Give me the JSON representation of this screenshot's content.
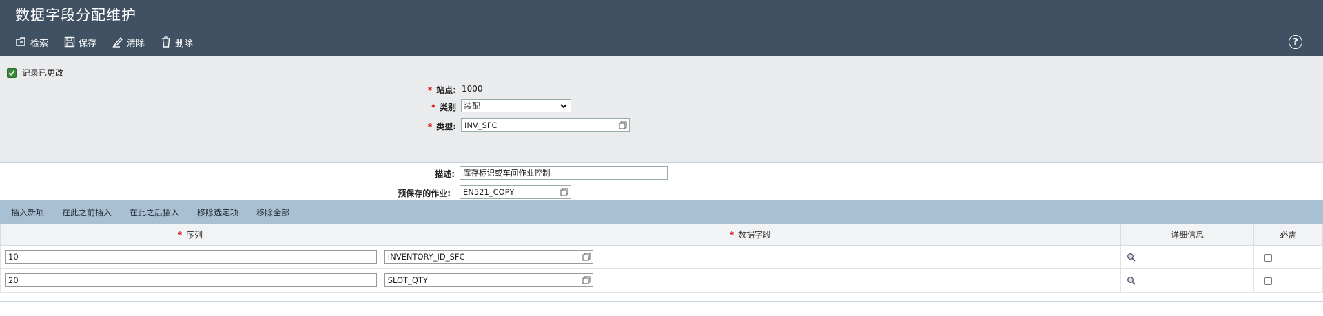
{
  "header": {
    "title": "数据字段分配维护",
    "toolbar": {
      "search": "检索",
      "save": "保存",
      "clear": "清除",
      "delete": "删除"
    },
    "help": "?"
  },
  "form": {
    "record_changed": "记录已更改",
    "site_label": "站点:",
    "site_value": "1000",
    "category_label": "类别",
    "category_value": "装配",
    "type_label": "类型:",
    "type_value": "INV_SFC",
    "desc_label": "描述:",
    "desc_value": "库存标识或车间作业控制",
    "prestore_label": "预保存的作业:",
    "prestore_value": "EN521_COPY"
  },
  "table_toolbar": {
    "insert_new": "插入新项",
    "insert_before": "在此之前插入",
    "insert_after": "在此之后插入",
    "remove_selected": "移除选定项",
    "remove_all": "移除全部"
  },
  "table": {
    "headers": {
      "sequence": "序列",
      "data_field": "数据字段",
      "details": "详细信息",
      "required": "必需"
    },
    "rows": [
      {
        "sequence": "10",
        "data_field": "INVENTORY_ID_SFC"
      },
      {
        "sequence": "20",
        "data_field": "SLOT_QTY"
      }
    ]
  },
  "colors": {
    "header_bg": "#3f5163",
    "panel_bg": "#eaebed",
    "toolbar_bg": "#a9bfd3",
    "required": "#d00000",
    "checkbox_green": "#3b8c3a"
  }
}
